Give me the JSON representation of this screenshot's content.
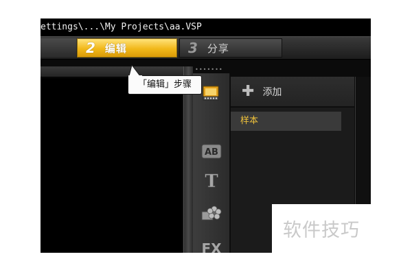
{
  "title_bar": {
    "path": "ettings\\...\\My Projects\\aa.VSP"
  },
  "steps": [
    {
      "number": "2",
      "label": "编辑",
      "active": true
    },
    {
      "number": "3",
      "label": "分享",
      "active": false
    }
  ],
  "tooltip": {
    "text": "「编辑」步骤"
  },
  "library": {
    "grip": "•••••••",
    "add_label": "添加",
    "items": [
      {
        "label": "样本",
        "selected": true
      }
    ],
    "tools": [
      "media-icon",
      "transition-icon",
      "title-icon",
      "graphics-icon",
      "filter-icon"
    ],
    "tool_labels": {
      "transition": "AB",
      "title": "T",
      "filter": "FX"
    }
  },
  "watermark": {
    "text": "软件技巧"
  },
  "colors": {
    "accent_gold": "#f1b81a",
    "sample_text": "#f0c23a",
    "background": "#0b0b0b"
  }
}
